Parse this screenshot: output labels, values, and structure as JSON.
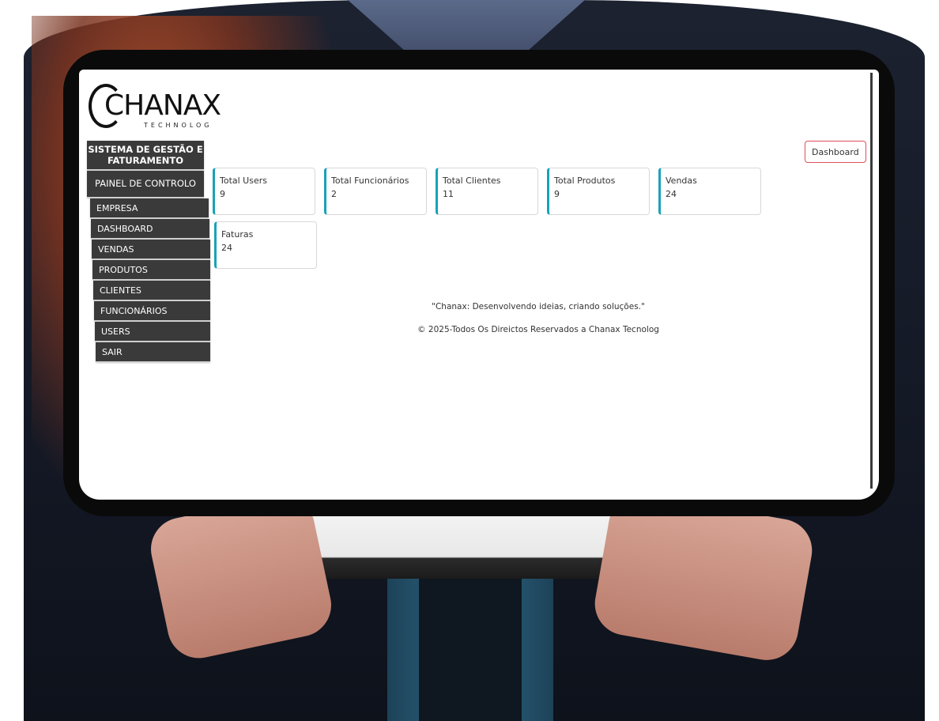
{
  "logo": {
    "word": "CHANAX",
    "subtitle": "TECHNOLOG"
  },
  "sidebar": {
    "title": "SISTEMA DE GESTÃO E FATURAMENTO",
    "panel_label": "PAINEL DE CONTROLO",
    "items": [
      {
        "label": "EMPRESA"
      },
      {
        "label": "DASHBOARD"
      },
      {
        "label": "VENDAS"
      },
      {
        "label": "PRODUTOS"
      },
      {
        "label": "CLIENTES"
      },
      {
        "label": "FUNCIONÁRIOS"
      },
      {
        "label": "USERS"
      },
      {
        "label": "SAIR"
      }
    ]
  },
  "header": {
    "dashboard_button": "Dashboard"
  },
  "stats": [
    {
      "label": "Total Users",
      "value": "9"
    },
    {
      "label": "Total Funcionários",
      "value": "2"
    },
    {
      "label": "Total Clientes",
      "value": "11"
    },
    {
      "label": "Total Produtos",
      "value": "9"
    },
    {
      "label": "Vendas",
      "value": "24"
    },
    {
      "label": "Faturas",
      "value": "24"
    }
  ],
  "footer": {
    "tagline": "\"Chanax: Desenvolvendo ideias, criando soluções.\"",
    "copyright": "© 2025-Todos Os Direictos Reservados a Chanax Tecnolog"
  },
  "colors": {
    "accent": "#17a2b8",
    "button_border": "#e0505a",
    "sidebar_bg": "#3a3a3a"
  }
}
